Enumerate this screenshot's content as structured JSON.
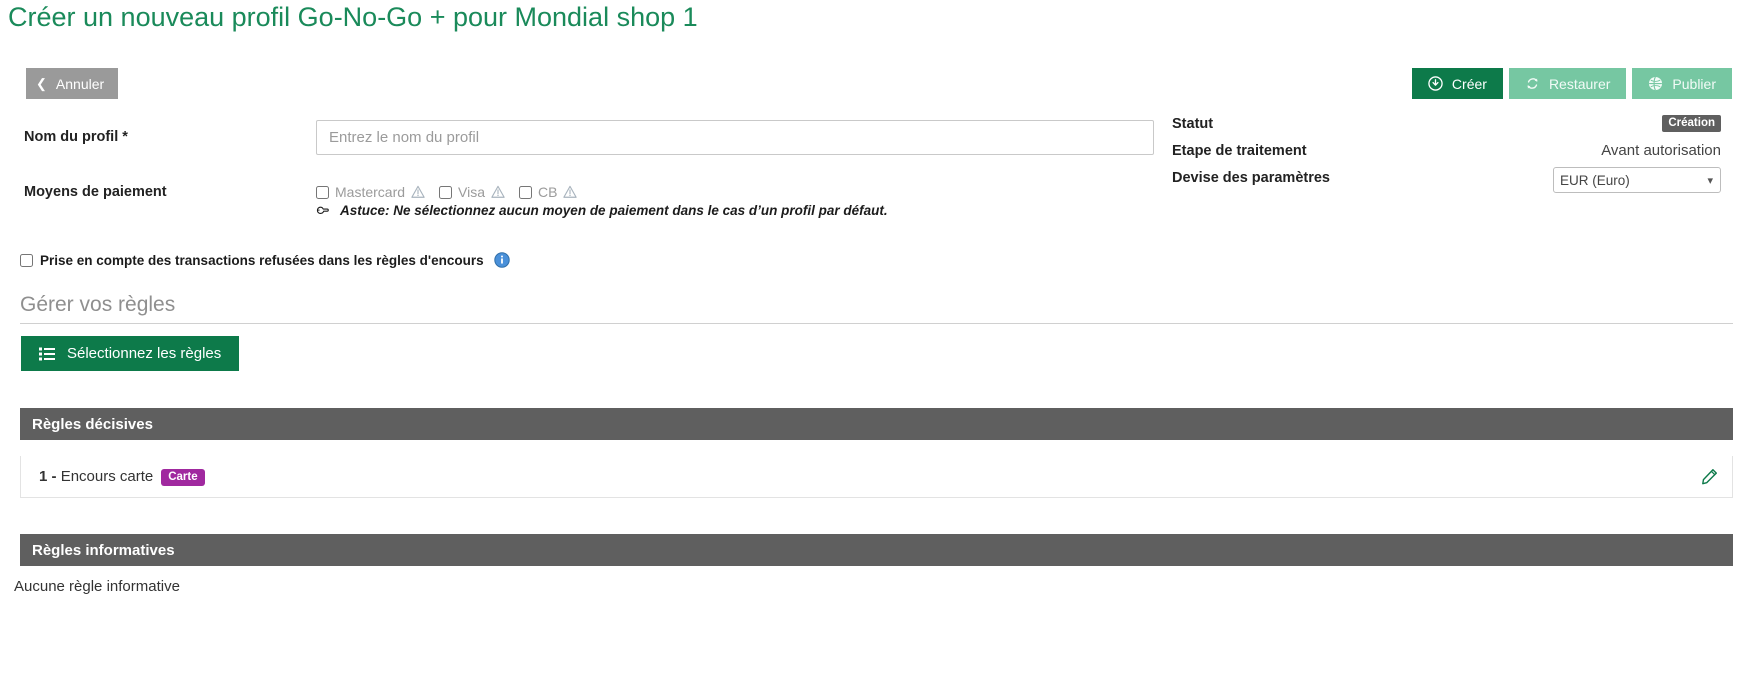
{
  "page": {
    "title": "Créer un nouveau profil Go-No-Go + pour Mondial shop 1",
    "title_color": "#1a8a5a"
  },
  "toolbar": {
    "cancel_label": "Annuler",
    "cancel_icon": "chevron-left-icon",
    "actions": [
      {
        "label": "Créer",
        "icon": "download-circle-icon",
        "state": "active"
      },
      {
        "label": "Restaurer",
        "icon": "refresh-icon",
        "state": "disabled"
      },
      {
        "label": "Publier",
        "icon": "globe-icon",
        "state": "disabled"
      }
    ],
    "primary_color": "#0d7a4a",
    "muted_color": "#76c7a2"
  },
  "form": {
    "profile_name_label": "Nom du profil *",
    "profile_name_value": "",
    "profile_name_placeholder": "Entrez le nom du profil",
    "payment_label": "Moyens de paiement",
    "payment_methods": [
      {
        "label": "Mastercard",
        "checked": false,
        "warning": true
      },
      {
        "label": "Visa",
        "checked": false,
        "warning": true
      },
      {
        "label": "CB",
        "checked": false,
        "warning": true
      }
    ],
    "tip_icon": "pointing-hand-icon",
    "tip_text": "Astuce: Ne sélectionnez aucun moyen de paiement dans le cas d’un profil par défaut.",
    "refused_checkbox_label": "Prise en compte des transactions refusées dans les règles d'encours",
    "refused_checkbox_checked": false,
    "refused_info_icon": "info-icon"
  },
  "status": {
    "statut_label": "Statut",
    "statut_value": "Création",
    "statut_badge_color": "#5f5f5f",
    "etape_label": "Etape de traitement",
    "etape_value": "Avant autorisation",
    "devise_label": "Devise des paramètres",
    "devise_value": "EUR (Euro)",
    "devise_chevron": "chevron-down-icon"
  },
  "rules": {
    "section_title": "Gérer vos règles",
    "select_button_label": "Sélectionnez les règles",
    "select_button_icon": "list-icon",
    "decisive": {
      "header": "Règles décisives",
      "items": [
        {
          "index": "1 - ",
          "name": "Encours carte",
          "badge": "Carte",
          "badge_color": "#a0299f",
          "edit_icon": "pencil-icon"
        }
      ]
    },
    "informative": {
      "header": "Règles informatives",
      "empty_text": "Aucune règle informative"
    }
  }
}
